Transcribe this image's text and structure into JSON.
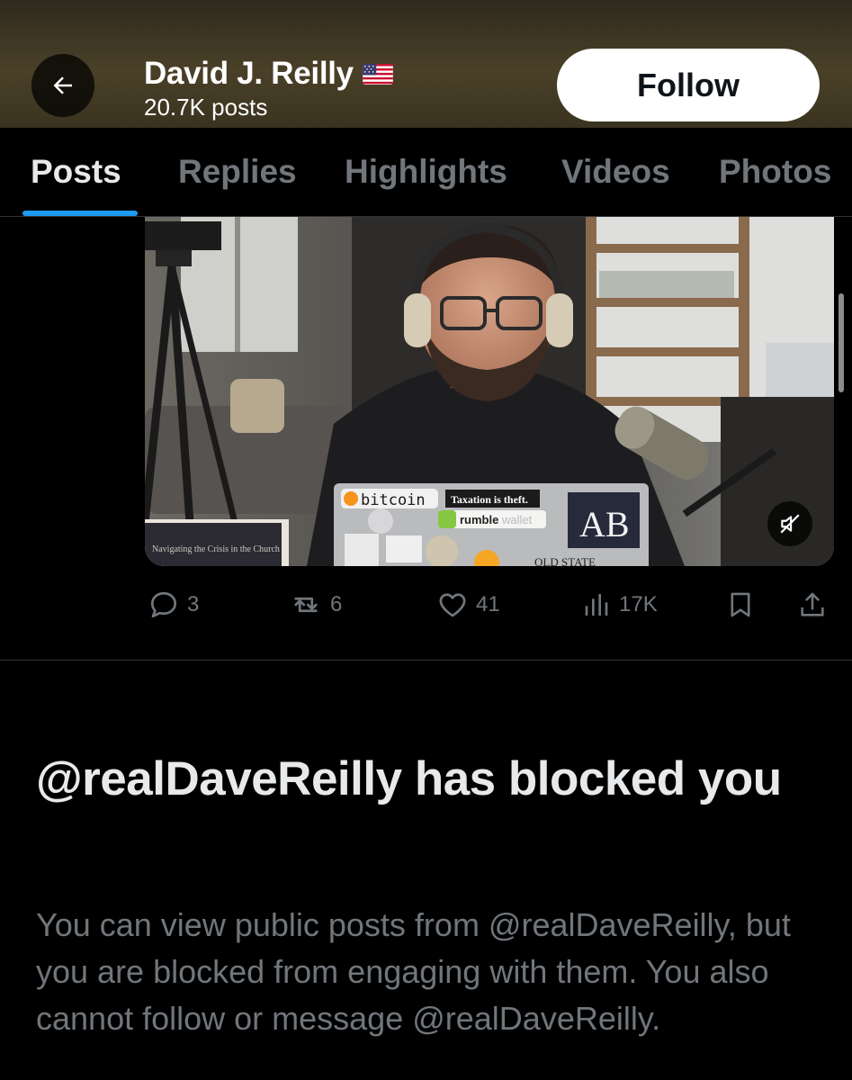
{
  "header": {
    "name": "David J. Reilly",
    "flag_icon": "us-flag-icon",
    "post_count": "20.7K posts",
    "follow_label": "Follow"
  },
  "tabs": [
    {
      "label": "Posts",
      "active": true
    },
    {
      "label": "Replies",
      "active": false
    },
    {
      "label": "Highlights",
      "active": false
    },
    {
      "label": "Videos",
      "active": false
    },
    {
      "label": "Photos",
      "active": false
    }
  ],
  "video": {
    "laptop_stickers": {
      "bitcoin": "bitcoin",
      "taxation": "Taxation is theft.",
      "rumble": "rumble",
      "rumble_suffix": "wallet",
      "ab": "AB",
      "old_state": "OLD STATE"
    },
    "book_text": "Navigating the Crisis in the Church",
    "muted": true
  },
  "post_stats": {
    "replies": "3",
    "reposts": "6",
    "likes": "41",
    "views": "17K"
  },
  "blocked": {
    "title": "@realDaveReilly has blocked you",
    "body": "You can view public posts from @realDaveReilly, but you are blocked from engaging with them. You also cannot follow or message @realDaveReilly."
  },
  "colors": {
    "accent": "#1d9bf0",
    "muted_text": "#71767b",
    "primary_text": "#e7e9ea",
    "background": "#000000"
  }
}
